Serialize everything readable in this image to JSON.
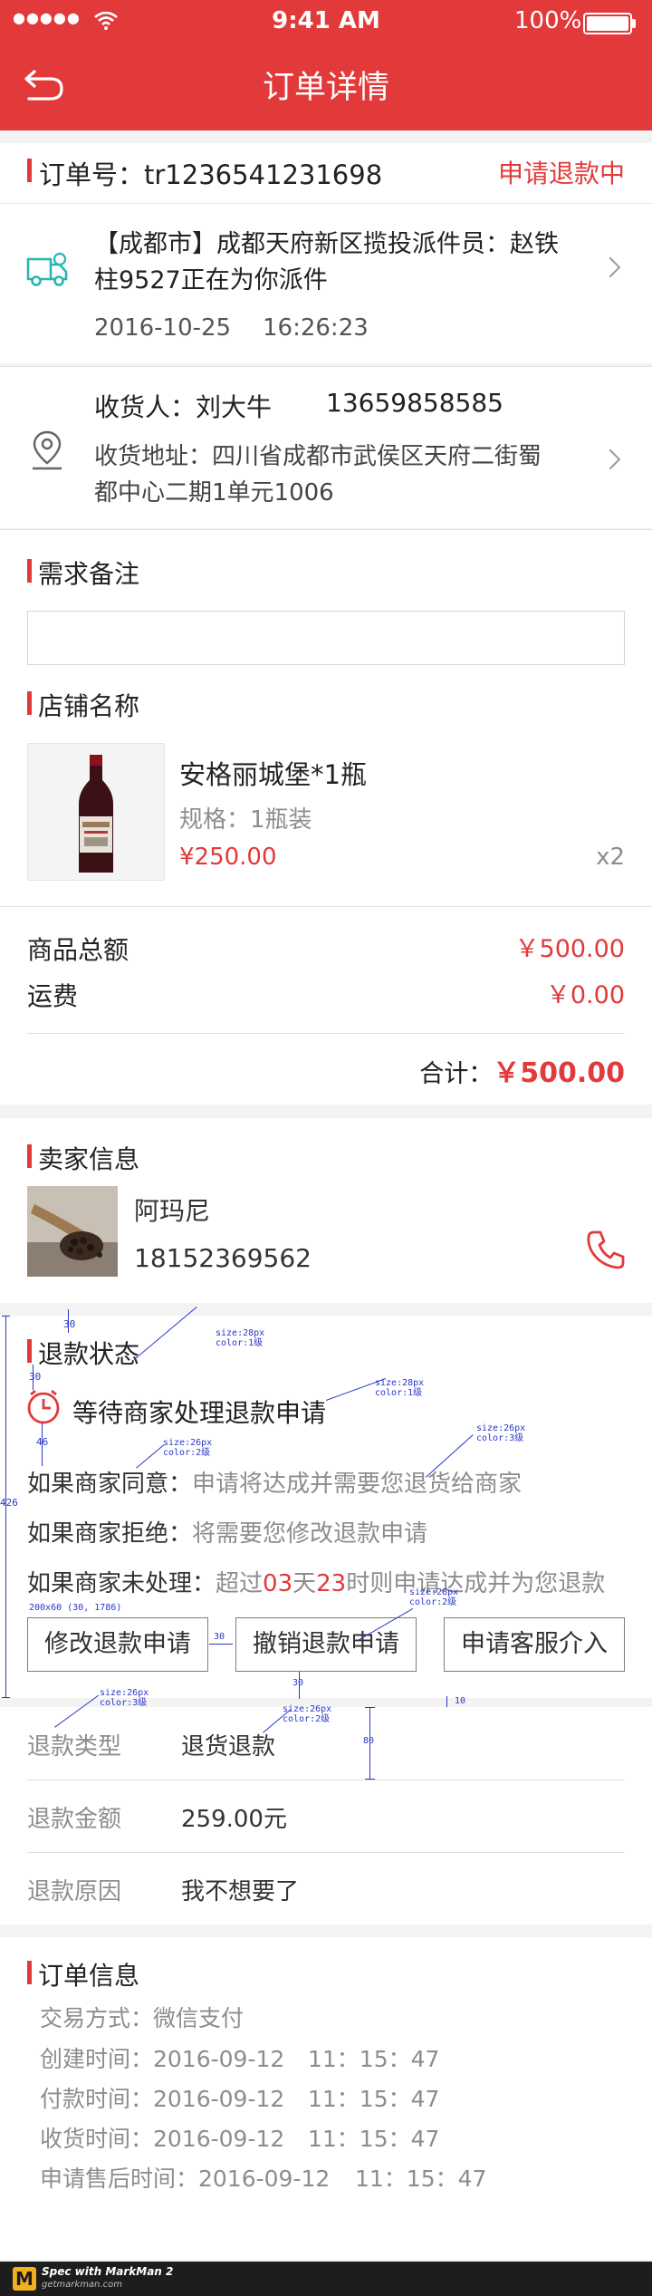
{
  "status_bar": {
    "carrier": "●●●●●",
    "time": "9:41 AM",
    "battery": "100%"
  },
  "nav": {
    "title": "订单详情",
    "back_icon": "back-arrow-icon"
  },
  "order": {
    "label": "订单号：tr1236541231698",
    "status": "申请退款中"
  },
  "logistics": {
    "text": "【成都市】成都天府新区揽投派件员：赵铁柱9527正在为你派件",
    "date": "2016-10-25",
    "time": "16:26:23"
  },
  "receiver": {
    "name": "收货人：刘大牛",
    "phone": "13659858585",
    "address": "收货地址：四川省成都市武侯区天府二街蜀都中心二期1单元1006"
  },
  "remark": {
    "title": "需求备注",
    "value": ""
  },
  "shop": {
    "title": "店铺名称",
    "product_name": "安格丽城堡*1瓶",
    "product_spec": "规格：1瓶装",
    "product_price": "¥250.00",
    "quantity": "x2"
  },
  "totals": {
    "goods_label": "商品总额",
    "goods_value": "￥500.00",
    "freight_label": "运费",
    "freight_value": "￥0.00",
    "sum_label": "合计：",
    "sum_value": "￥500.00"
  },
  "seller": {
    "title": "卖家信息",
    "name": "阿玛尼",
    "phone": "18152369562"
  },
  "refund_status": {
    "title": "退款状态",
    "waiting": "等待商家处理退款申请",
    "agree_label": "如果商家同意：",
    "agree_text": "申请将达成并需要您退货给商家",
    "reject_label": "如果商家拒绝：",
    "reject_text": "将需要您修改退款申请",
    "noact_label": "如果商家未处理：",
    "noact_pre": "超过",
    "noact_days": "03",
    "noact_day_unit": "天",
    "noact_hours": "23",
    "noact_post": "时则申请达成并为您退款",
    "buttons": [
      "修改退款申请",
      "撤销退款申请",
      "申请客服介入"
    ]
  },
  "refund_info": [
    {
      "label": "退款类型",
      "value": "退货退款"
    },
    {
      "label": "退款金额",
      "value": "259.00元"
    },
    {
      "label": "退款原因",
      "value": "我不想要了"
    }
  ],
  "order_info": {
    "title": "订单信息",
    "pay_method": "交易方式：微信支付",
    "rows": [
      {
        "label": "创建时间：2016-09-12",
        "time": "11：15：47"
      },
      {
        "label": "付款时间：2016-09-12",
        "time": "11：15：47"
      },
      {
        "label": "收货时间：2016-09-12",
        "time": "11：15：47"
      },
      {
        "label": "申请售后时间：2016-09-12",
        "time": "11：15：47"
      }
    ]
  },
  "annotations": {
    "dim_30a": "30",
    "dim_30b": "30",
    "dim_46": "46",
    "dim_426": "426",
    "dim_30c": "30",
    "dim_30d": "30",
    "dim_10": "10",
    "dim_80": "80",
    "title_size": "size:28px\ncolor:1级",
    "wait_size": "size:28px\ncolor:1级",
    "agree_size": "size:26px\ncolor:2级",
    "agree_text_size": "size:26px\ncolor:3级",
    "btn_size": "size:28px\ncolor:2级",
    "btn_box": "200x60 (30, 1786)",
    "type_label_size": "size:26px\ncolor:3级",
    "type_value_size": "size:26px\ncolor:2级"
  },
  "footer": {
    "brand_letter": "M",
    "line1": "Spec with MarkMan 2",
    "line2": "getmarkman.com"
  },
  "colors": {
    "accent": "#e23a3a",
    "teal": "#28b6b0",
    "annotation": "#2a37c9"
  }
}
